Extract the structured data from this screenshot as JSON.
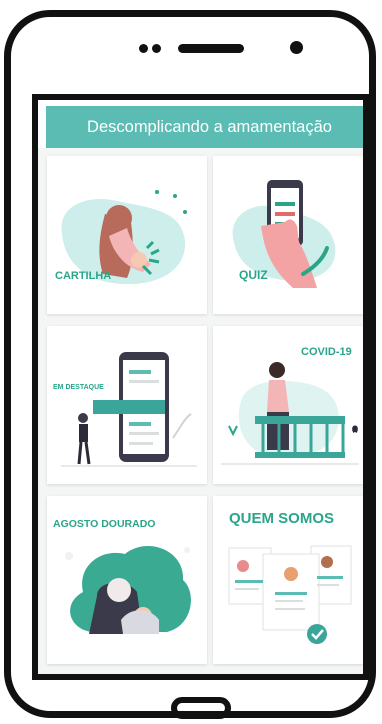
{
  "app": {
    "title": "Descomplicando a amamentação"
  },
  "cards": [
    {
      "label": "CARTILHA"
    },
    {
      "label": "QUIZ"
    },
    {
      "label": "EM DESTAQUE"
    },
    {
      "label": "COVID-19"
    },
    {
      "label": "AGOSTO DOURADO"
    },
    {
      "label": "QUEM SOMOS"
    }
  ],
  "colors": {
    "accent": "#5bbcb3",
    "label": "#2aa58a",
    "blob": "#cdeeeb"
  }
}
